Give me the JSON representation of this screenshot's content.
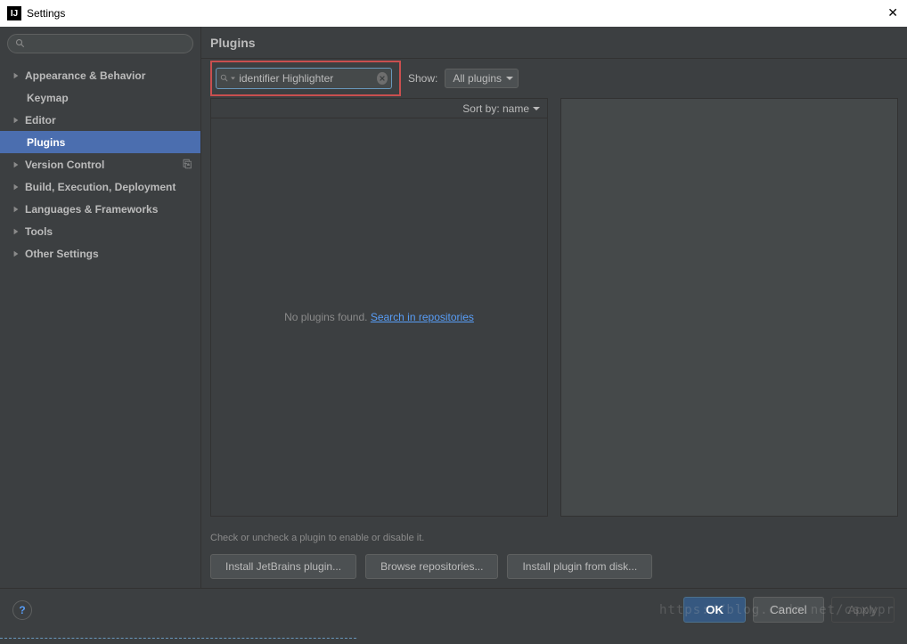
{
  "titlebar": {
    "icon": "IJ",
    "title": "Settings"
  },
  "sidebar": {
    "items": [
      {
        "label": "Appearance & Behavior",
        "arrow": true,
        "bold": true
      },
      {
        "label": "Keymap",
        "arrow": false,
        "bold": true,
        "child": true
      },
      {
        "label": "Editor",
        "arrow": true,
        "bold": true
      },
      {
        "label": "Plugins",
        "arrow": false,
        "bold": true,
        "child": true,
        "selected": true
      },
      {
        "label": "Version Control",
        "arrow": true,
        "bold": true,
        "copyicon": true
      },
      {
        "label": "Build, Execution, Deployment",
        "arrow": true,
        "bold": true
      },
      {
        "label": "Languages & Frameworks",
        "arrow": true,
        "bold": true
      },
      {
        "label": "Tools",
        "arrow": true,
        "bold": true
      },
      {
        "label": "Other Settings",
        "arrow": true,
        "bold": true
      }
    ]
  },
  "content": {
    "header": "Plugins",
    "search_value": "identifier Highlighter",
    "show_label": "Show:",
    "show_value": "All plugins",
    "sort_label": "Sort by: name",
    "empty_text": "No plugins found. ",
    "search_link": "Search in repositories",
    "hint": "Check or uncheck a plugin to enable or disable it.",
    "buttons": {
      "install_jb": "Install JetBrains plugin...",
      "browse": "Browse repositories...",
      "install_disk": "Install plugin from disk..."
    }
  },
  "footer": {
    "ok": "OK",
    "cancel": "Cancel",
    "apply": "Apply"
  },
  "watermark": "https://blog.csdn.net/csxypr"
}
